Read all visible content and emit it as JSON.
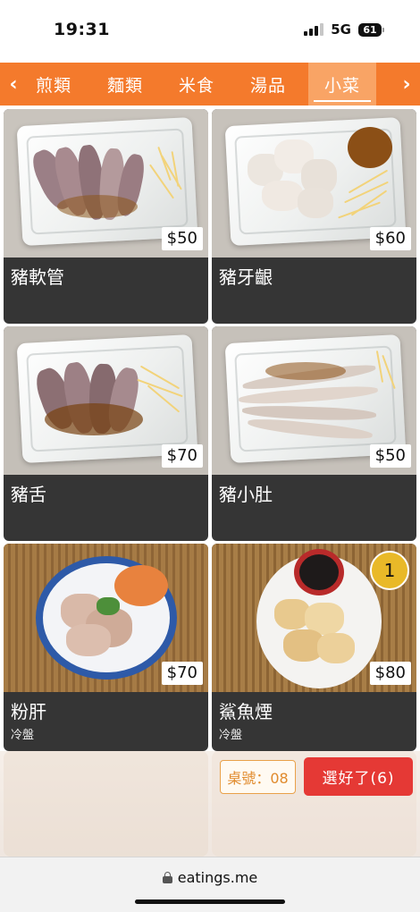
{
  "status_bar": {
    "time": "19:31",
    "network": "5G",
    "battery": "61",
    "icons": [
      "signal-icon",
      "battery-icon"
    ]
  },
  "nav": {
    "prev_icon": "‹",
    "next_icon": "›",
    "tabs": [
      {
        "label": "煎類",
        "active": false
      },
      {
        "label": "麵類",
        "active": false
      },
      {
        "label": "米食",
        "active": false
      },
      {
        "label": "湯品",
        "active": false
      },
      {
        "label": "小菜",
        "active": true
      }
    ]
  },
  "menu": {
    "items": [
      {
        "name": "豬軟管",
        "price": "$50",
        "note": "",
        "quantity": ""
      },
      {
        "name": "豬牙齦",
        "price": "$60",
        "note": "",
        "quantity": ""
      },
      {
        "name": "豬舌",
        "price": "$70",
        "note": "",
        "quantity": ""
      },
      {
        "name": "豬小肚",
        "price": "$50",
        "note": "",
        "quantity": ""
      },
      {
        "name": "粉肝",
        "price": "$70",
        "note": "冷盤",
        "quantity": ""
      },
      {
        "name": "鯊魚煙",
        "price": "$80",
        "note": "冷盤",
        "quantity": "1"
      }
    ]
  },
  "footer": {
    "table_number": "桌號：08",
    "done_label": "選好了(6)"
  },
  "browser": {
    "url": "eatings.me"
  },
  "colors": {
    "tab_bar": "#f47a2c",
    "tab_active": "#f9a465",
    "card_bg": "#353535",
    "done_button": "#e53935",
    "qty_badge": "#e9b928"
  }
}
